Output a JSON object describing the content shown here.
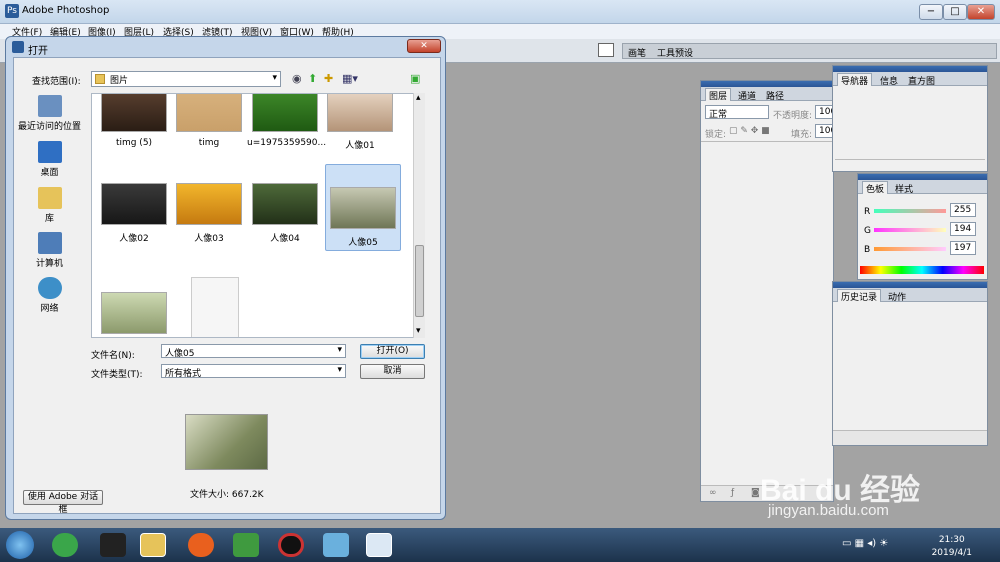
{
  "app": {
    "title": "Adobe Photoshop",
    "logo_letter": "Ps",
    "win_min": "−",
    "win_max": "□",
    "win_close": "✕"
  },
  "menubar": [
    "文件(F)",
    "编辑(E)",
    "图像(I)",
    "图层(L)",
    "选择(S)",
    "滤镜(T)",
    "视图(V)",
    "窗口(W)",
    "帮助(H)"
  ],
  "options_bar": {
    "tabs": [
      "画笔",
      "工具预设"
    ]
  },
  "layers_panel": {
    "tabs": [
      "图层",
      "通道",
      "路径"
    ],
    "blend_mode": "正常",
    "opacity_label": "不透明度:",
    "opacity_value": "100",
    "lock_label": "锁定:",
    "fill_label": "填充:",
    "fill_value": "100"
  },
  "navigator_panel": {
    "tabs": [
      "导航器",
      "信息",
      "直方图"
    ]
  },
  "color_panel": {
    "tabs": [
      "色板",
      "样式"
    ],
    "channels": [
      {
        "label": "R",
        "value": "255"
      },
      {
        "label": "G",
        "value": "194"
      },
      {
        "label": "B",
        "value": "197"
      }
    ]
  },
  "history_panel": {
    "tabs": [
      "历史记录",
      "动作"
    ]
  },
  "dialog": {
    "title": "打开",
    "close": "✕",
    "look_in_label": "查找范围(I):",
    "look_in_value": "图片",
    "places": [
      "最近访问的位置",
      "桌面",
      "库",
      "计算机",
      "网络"
    ],
    "files_row1": [
      "timg (5)",
      "timg",
      "u=1975359590...",
      "人像01"
    ],
    "files_row2": [
      "人像02",
      "人像03",
      "人像04",
      "人像05"
    ],
    "filename_label": "文件名(N):",
    "filename_value": "人像05",
    "filetype_label": "文件类型(T):",
    "filetype_value": "所有格式",
    "open_button": "打开(O)",
    "cancel_button": "取消",
    "file_size": "文件大小: 667.2K",
    "adobe_dialog_button": "使用 Adobe 对话框"
  },
  "taskbar": {
    "time": "21:30",
    "date": "2019/4/1"
  },
  "watermark": {
    "brand": "Bai du 经验",
    "url": "jingyan.baidu.com"
  },
  "colors": {
    "selection": "#cce0f6",
    "workspace": "#a3a3a3"
  }
}
